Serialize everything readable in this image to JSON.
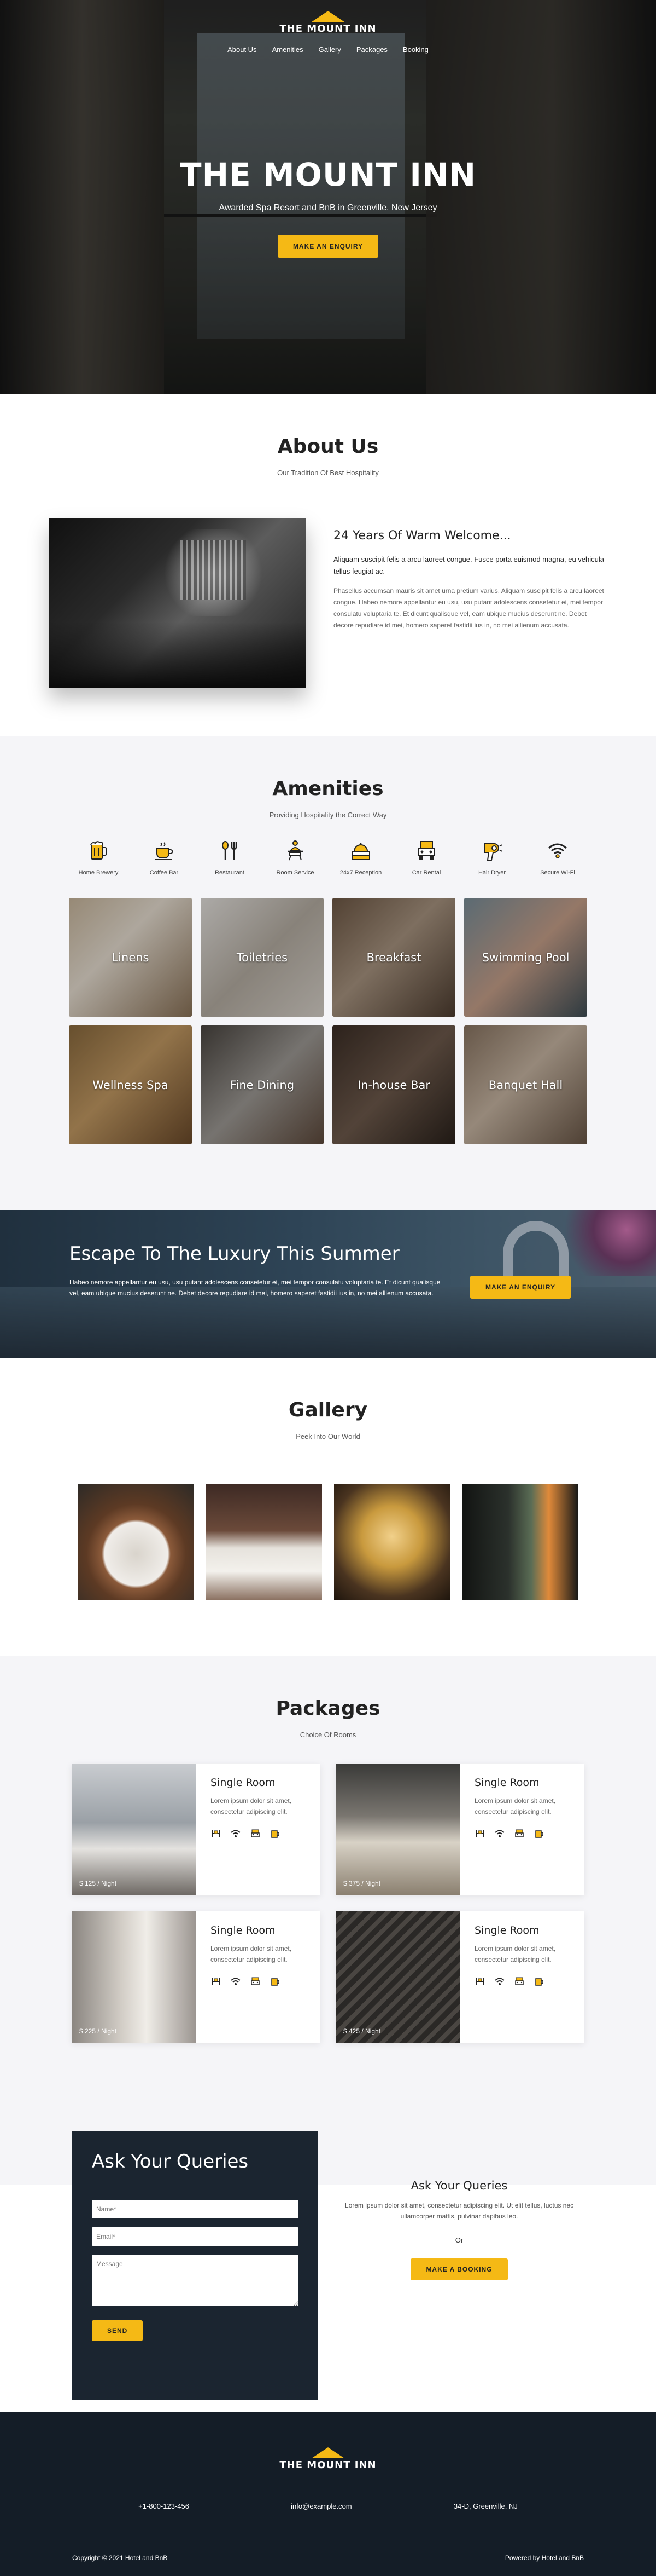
{
  "brand": {
    "name": "THE MOUNT INN",
    "accent": "#f5b915",
    "dark": "#1b2530"
  },
  "nav": {
    "items": [
      "About Us",
      "Amenities",
      "Gallery",
      "Packages",
      "Booking"
    ]
  },
  "hero": {
    "title": "THE MOUNT INN",
    "subtitle": "Awarded Spa Resort and BnB in Greenville, New Jersey",
    "cta": "MAKE AN ENQUIRY"
  },
  "about": {
    "title": "About Us",
    "subtitle": "Our Tradition Of Best Hospitality",
    "heading": "24 Years Of Warm Welcome...",
    "lead": "Aliquam suscipit felis a arcu laoreet congue. Fusce porta euismod magna, eu vehicula tellus feugiat ac.",
    "body": "Phasellus accumsan mauris sit amet urna pretium varius. Aliquam suscipit felis a arcu laoreet congue. Habeo nemore appellantur eu usu, usu putant adolescens consetetur ei, mei tempor consulatu voluptaria te. Et dicunt qualisque vel, eam ubique mucius deserunt ne. Debet decore repudiare id mei, homero saperet fastidii ius in, no mei allienum accusata."
  },
  "amenities": {
    "title": "Amenities",
    "subtitle": "Providing Hospitality the Correct Way",
    "icons": [
      {
        "label": "Home Brewery",
        "icon": "beer-mug-icon"
      },
      {
        "label": "Coffee Bar",
        "icon": "coffee-cup-icon"
      },
      {
        "label": "Restaurant",
        "icon": "cutlery-icon"
      },
      {
        "label": "Room Service",
        "icon": "room-service-icon"
      },
      {
        "label": "24x7 Reception",
        "icon": "reception-bell-icon"
      },
      {
        "label": "Car Rental",
        "icon": "car-icon"
      },
      {
        "label": "Hair Dryer",
        "icon": "hair-dryer-icon"
      },
      {
        "label": "Secure Wi-Fi",
        "icon": "wifi-icon"
      }
    ],
    "tiles": [
      "Linens",
      "Toiletries",
      "Breakfast",
      "Swimming Pool",
      "Wellness Spa",
      "Fine Dining",
      "In-house Bar",
      "Banquet Hall"
    ]
  },
  "promo": {
    "title": "Escape To The Luxury This Summer",
    "text": "Habeo nemore appellantur eu usu, usu putant adolescens consetetur ei, mei tempor consulatu voluptaria te. Et dicunt qualisque vel, eam ubique mucius deserunt ne. Debet decore repudiare id mei, homero saperet fastidii ius in, no mei allienum accusata.",
    "cta": "MAKE AN ENQUIRY"
  },
  "gallery": {
    "title": "Gallery",
    "subtitle": "Peek Into Our World"
  },
  "packages": {
    "title": "Packages",
    "subtitle": "Choice Of Rooms",
    "items": [
      {
        "name": "Single Room",
        "desc": "Lorem ipsum dolor sit amet, consectetur adipiscing elit.",
        "price": "$ 125 / Night"
      },
      {
        "name": "Single Room",
        "desc": "Lorem ipsum dolor sit amet, consectetur adipiscing elit.",
        "price": "$ 375 / Night"
      },
      {
        "name": "Single Room",
        "desc": "Lorem ipsum dolor sit amet, consectetur adipiscing elit.",
        "price": "$ 225 / Night"
      },
      {
        "name": "Single Room",
        "desc": "Lorem ipsum dolor sit amet, consectetur adipiscing elit.",
        "price": "$ 425 / Night"
      }
    ]
  },
  "queries": {
    "title": "Ask Your Queries",
    "name_placeholder": "Name*",
    "email_placeholder": "Email*",
    "message_placeholder": "Message",
    "send": "SEND",
    "side_title": "Ask Your Queries",
    "side_text": "Lorem ipsum dolor sit amet, consectetur adipiscing elit. Ut elit tellus, luctus nec ullamcorper mattis, pulvinar dapibus leo.",
    "or": "Or",
    "booking": "MAKE A BOOKING"
  },
  "footer": {
    "phone": "+1-800-123-456",
    "email": "info@example.com",
    "address": "34-D, Greenville, NJ",
    "copyright": "Copyright © 2021 Hotel and BnB",
    "powered": "Powered by Hotel and BnB"
  }
}
